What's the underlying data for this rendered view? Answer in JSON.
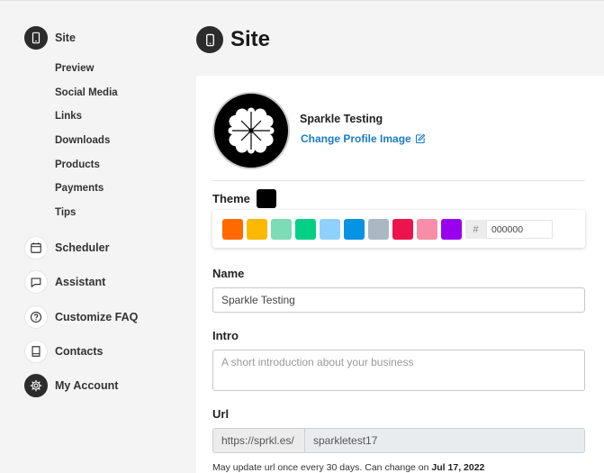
{
  "sidebar": {
    "items": [
      {
        "label": "Site",
        "icon": "phone-icon",
        "active": true
      },
      {
        "label": "Scheduler",
        "icon": "calendar-icon"
      },
      {
        "label": "Assistant",
        "icon": "chat-icon"
      },
      {
        "label": "Customize FAQ",
        "icon": "question-icon"
      },
      {
        "label": "Contacts",
        "icon": "book-icon"
      },
      {
        "label": "My Account",
        "icon": "gear-icon",
        "active": true
      }
    ],
    "site_subitems": [
      "Preview",
      "Social Media",
      "Links",
      "Downloads",
      "Products",
      "Payments",
      "Tips"
    ]
  },
  "header": {
    "title": "Site",
    "icon": "phone-icon"
  },
  "profile": {
    "name": "Sparkle Testing",
    "change_image_label": "Change Profile Image",
    "avatar_icon": "clover-logo-icon"
  },
  "theme": {
    "label": "Theme",
    "selected_color": "#000000",
    "swatches": [
      "#ff6900",
      "#fcb900",
      "#7bdcb5",
      "#00d084",
      "#8ed1fc",
      "#0693e3",
      "#abb8c3",
      "#eb144c",
      "#f78da7",
      "#9900ef"
    ],
    "hash_symbol": "#",
    "hex_value": "000000"
  },
  "name_field": {
    "label": "Name",
    "value": "Sparkle Testing"
  },
  "intro_field": {
    "label": "Intro",
    "placeholder": "A short introduction about your business"
  },
  "url_field": {
    "label": "Url",
    "prefix": "https://sprkl.es/",
    "value": "sparkletest17",
    "note": "May update url once every 30 days. Can change on",
    "note_date": "Jul 17, 2022"
  }
}
